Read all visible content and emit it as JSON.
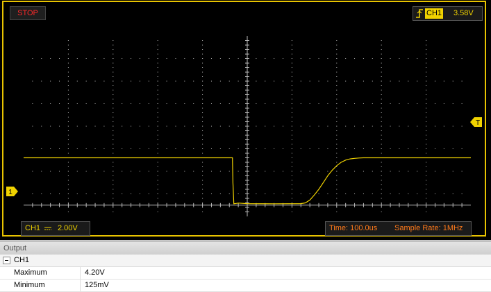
{
  "status": {
    "label": "STOP",
    "color": "#ff2a2a"
  },
  "trigger": {
    "channel": "CH1",
    "level": "3.58V",
    "edge_icon": "rising-edge-icon"
  },
  "channel_info": {
    "name": "CH1",
    "coupling_icon": "dc-coupling-icon",
    "volts_per_div": "2.00V"
  },
  "timebase": {
    "time_label": "Time: 100.0us",
    "sample_rate_label": "Sample Rate: 1MHz"
  },
  "markers": {
    "ch1_marker": "1",
    "trigger_marker": "T"
  },
  "colors": {
    "trace": "#f0d200",
    "frame": "#e8c300",
    "grid": "#bdbdbd",
    "timebox_text": "#ff7a1a"
  },
  "output": {
    "header": "Output",
    "channel": "CH1",
    "rows": [
      {
        "label": "Maximum",
        "value": "4.20V"
      },
      {
        "label": "Minimum",
        "value": "125mV"
      }
    ]
  },
  "chart_data": {
    "type": "line",
    "x_divisions": 10,
    "y_divisions": 8,
    "time_per_div_us": 100,
    "volts_per_div": 2,
    "ylim": [
      -1.0,
      15.0
    ],
    "xlim": [
      0,
      1000
    ],
    "grid": true,
    "series": [
      {
        "x": [
          0,
          467,
          468,
          470,
          480,
          500,
          560,
          620,
          630,
          640,
          650,
          660,
          670,
          680,
          690,
          700,
          710,
          720,
          730,
          740,
          750,
          760,
          770,
          790,
          800,
          1000
        ],
        "y": [
          4.2,
          4.2,
          2.0,
          0.12,
          0.18,
          0.13,
          0.12,
          0.13,
          0.2,
          0.45,
          0.9,
          1.4,
          2.0,
          2.6,
          3.1,
          3.5,
          3.8,
          4.0,
          4.1,
          4.15,
          4.18,
          4.2,
          4.2,
          4.2,
          4.2,
          4.2
        ]
      }
    ]
  }
}
